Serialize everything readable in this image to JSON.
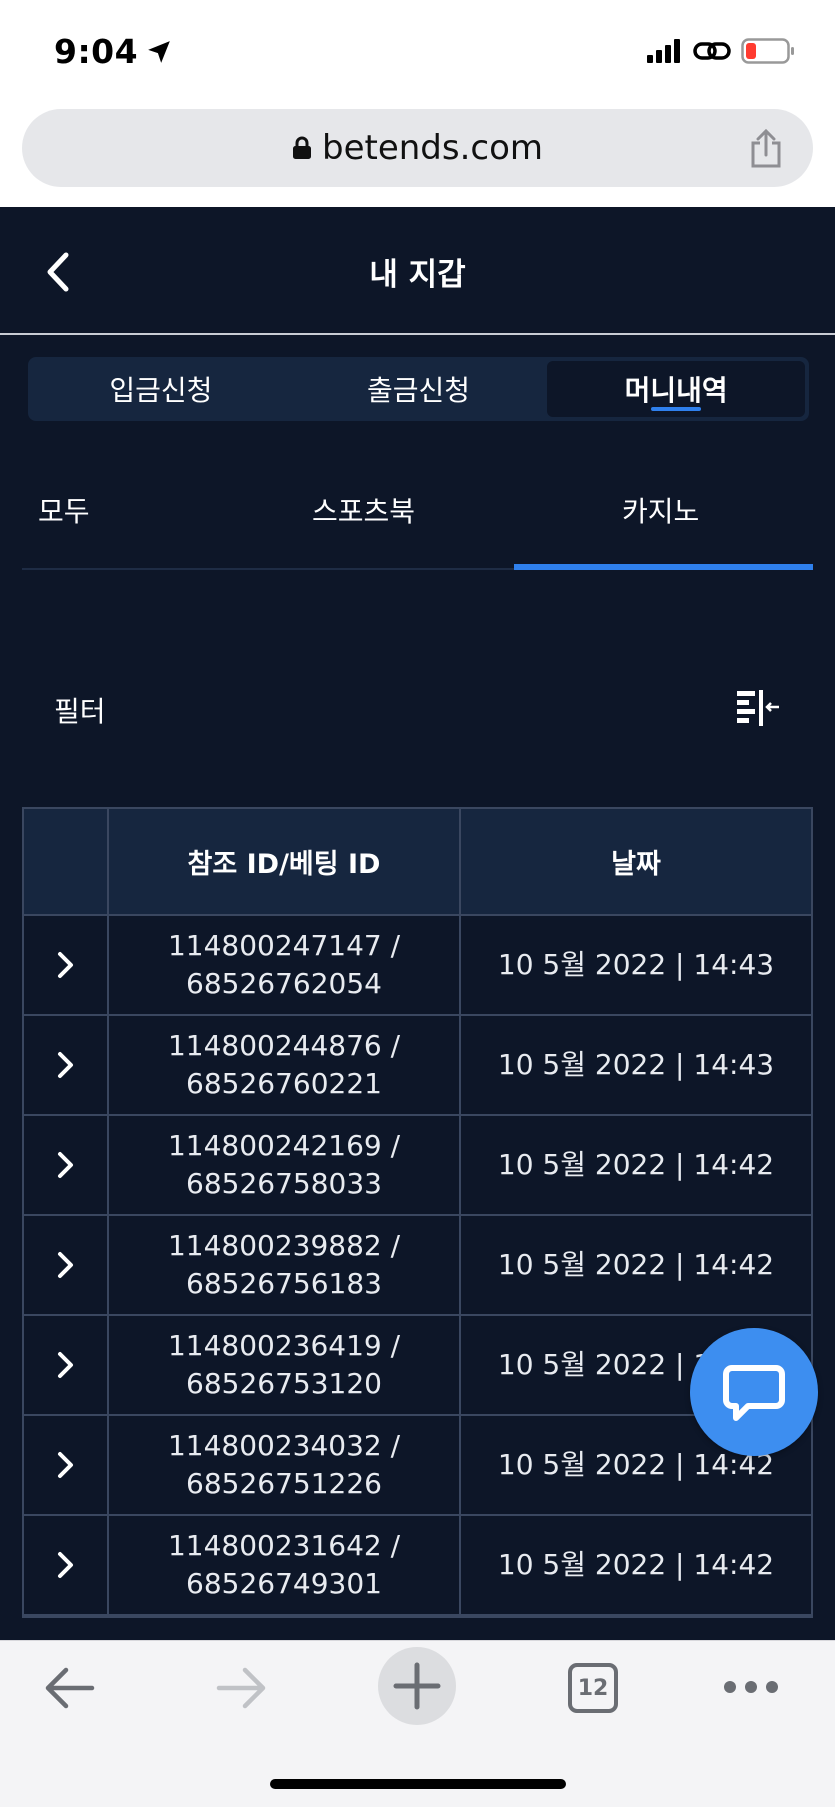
{
  "status_bar": {
    "time": "9:04"
  },
  "browser": {
    "url": "betends.com",
    "tab_count": "12"
  },
  "header": {
    "title": "내 지갑"
  },
  "segment_tabs": [
    {
      "label": "입금신청",
      "active": false
    },
    {
      "label": "출금신청",
      "active": false
    },
    {
      "label": "머니내역",
      "active": true
    }
  ],
  "sub_tabs": [
    {
      "label": "모두",
      "active": false
    },
    {
      "label": "스포츠북",
      "active": false
    },
    {
      "label": "카지노",
      "active": true
    }
  ],
  "filter": {
    "label": "필터"
  },
  "table": {
    "headers": [
      "",
      "참조 ID/베팅 ID",
      "날짜"
    ],
    "rows": [
      {
        "ref_id": "114800247147 /",
        "bet_id": "68526762054",
        "date": "10 5월 2022 | 14:43"
      },
      {
        "ref_id": "114800244876 /",
        "bet_id": "68526760221",
        "date": "10 5월 2022 | 14:43"
      },
      {
        "ref_id": "114800242169 /",
        "bet_id": "68526758033",
        "date": "10 5월 2022 | 14:42"
      },
      {
        "ref_id": "114800239882 /",
        "bet_id": "68526756183",
        "date": "10 5월 2022 | 14:42"
      },
      {
        "ref_id": "114800236419 /",
        "bet_id": "68526753120",
        "date": "10 5월 2022 | 14:42"
      },
      {
        "ref_id": "114800234032 /",
        "bet_id": "68526751226",
        "date": "10 5월 2022 | 14:42"
      },
      {
        "ref_id": "114800231642 /",
        "bet_id": "68526749301",
        "date": "10 5월 2022 | 14:42"
      }
    ]
  },
  "colors": {
    "background": "#0d1628",
    "accent": "#2f80ed",
    "chat": "#3d8ef0"
  }
}
